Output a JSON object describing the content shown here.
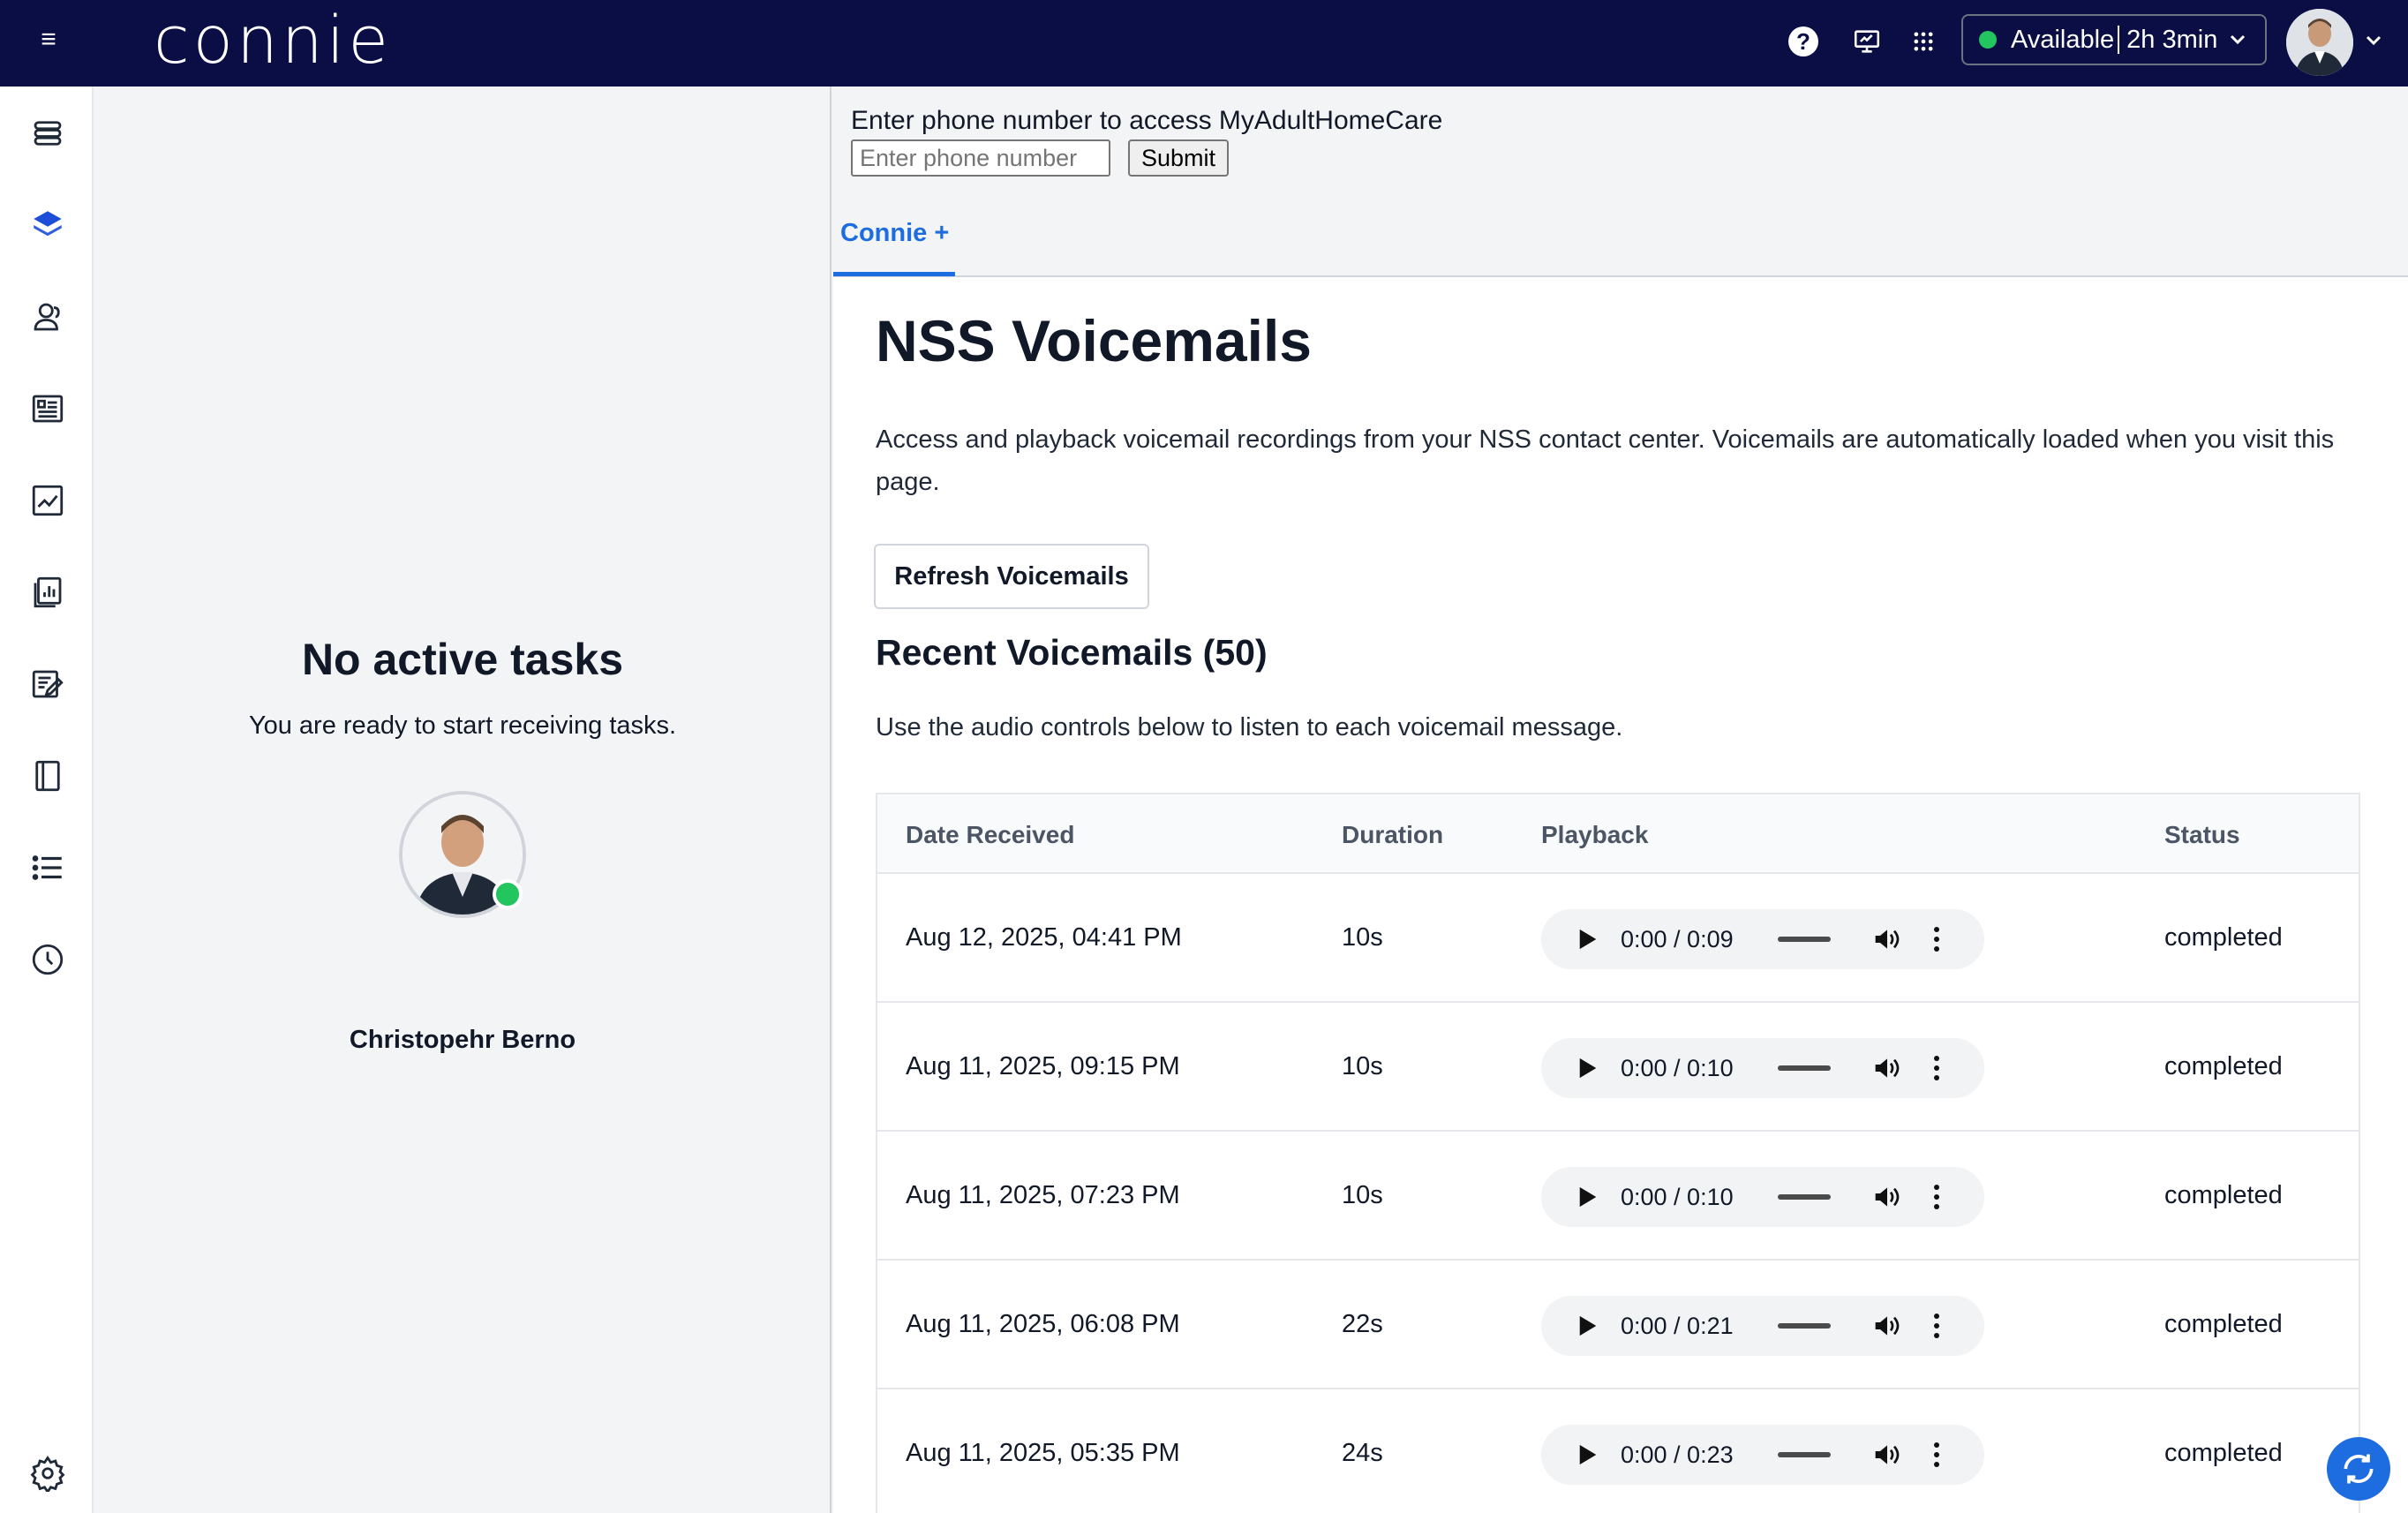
{
  "topbar": {
    "logo": "connie",
    "status_label": "Available",
    "status_timer": "2h 3min",
    "status_color": "#22c55e",
    "background": "#0b0e45",
    "icons": [
      "menu-icon",
      "help-icon",
      "screen-share-icon",
      "apps-grid-icon",
      "chevron-down-icon"
    ]
  },
  "rail": {
    "items": [
      "layers-stack-icon",
      "stack-icon",
      "contacts-icon",
      "directory-card-icon",
      "analytics-icon",
      "reports-icon",
      "edit-form-icon",
      "notebook-icon",
      "list-icon",
      "history-icon",
      "settings-icon"
    ],
    "active_index": 1,
    "accent": "#1d4ed8"
  },
  "tasks_panel": {
    "heading": "No active tasks",
    "subtext": "You are ready to start receiving tasks.",
    "agent_name": "Christopehr Berno"
  },
  "phone_access": {
    "label": "Enter phone number to access MyAdultHomeCare",
    "placeholder": "Enter phone number",
    "submit_label": "Submit"
  },
  "tabs": [
    {
      "label": "Connie +",
      "active": true
    }
  ],
  "voicemails": {
    "title": "NSS Voicemails",
    "description": "Access and playback voicemail recordings from your NSS contact center. Voicemails are automatically loaded when you visit this page.",
    "refresh_label": "Refresh Voicemails",
    "section_title": "Recent Voicemails (50)",
    "section_desc": "Use the audio controls below to listen to each voicemail message.",
    "columns": [
      "Date Received",
      "Duration",
      "Playback",
      "Status"
    ],
    "rows": [
      {
        "date": "Aug 12, 2025, 04:41 PM",
        "duration": "10s",
        "time": "0:00 / 0:09",
        "status": "completed"
      },
      {
        "date": "Aug 11, 2025, 09:15 PM",
        "duration": "10s",
        "time": "0:00 / 0:10",
        "status": "completed"
      },
      {
        "date": "Aug 11, 2025, 07:23 PM",
        "duration": "10s",
        "time": "0:00 / 0:10",
        "status": "completed"
      },
      {
        "date": "Aug 11, 2025, 06:08 PM",
        "duration": "22s",
        "time": "0:00 / 0:21",
        "status": "completed"
      },
      {
        "date": "Aug 11, 2025, 05:35 PM",
        "duration": "24s",
        "time": "0:00 / 0:23",
        "status": "completed"
      }
    ]
  },
  "accent_color": "#1d6ce0"
}
